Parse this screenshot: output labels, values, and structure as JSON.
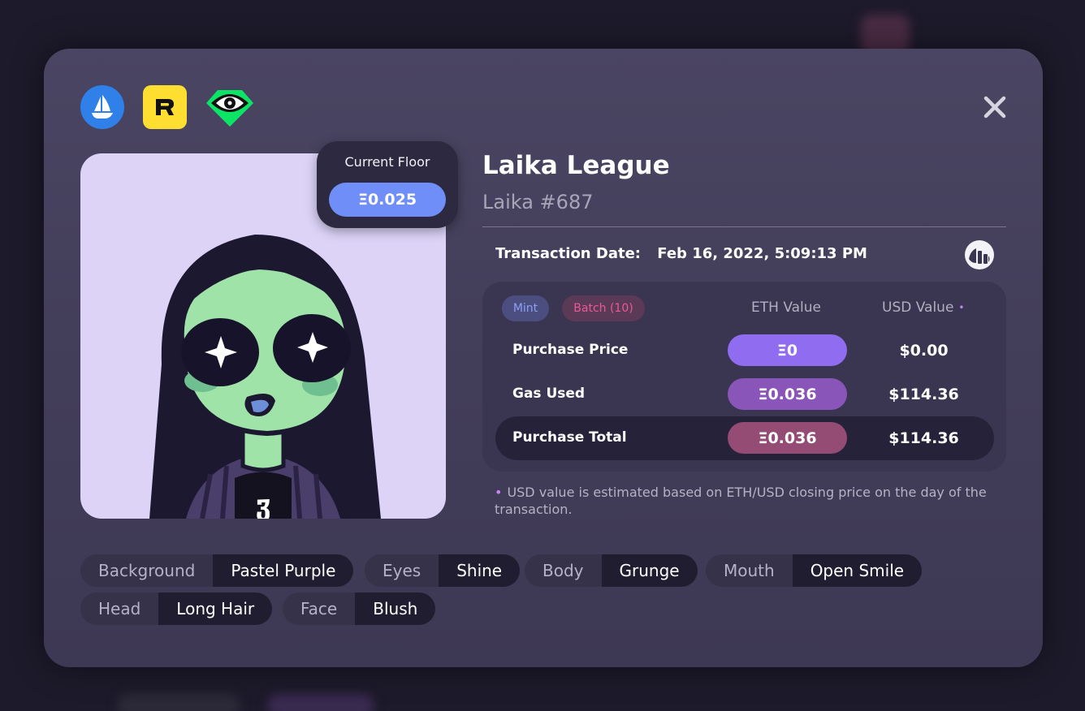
{
  "modal": {
    "marketplaces": [
      "opensea-icon",
      "rarible-icon",
      "looksrare-icon"
    ],
    "close_icon": "close-icon"
  },
  "floor": {
    "label": "Current Floor",
    "value": "Ξ0.025"
  },
  "nft": {
    "collection": "Laika League",
    "token": "Laika #687"
  },
  "transaction": {
    "date_label": "Transaction Date:",
    "date_value": "Feb 16, 2022, 5:09:13 PM",
    "chart_icon": "chart-icon",
    "tags": {
      "mint": "Mint",
      "batch": "Batch (10)"
    },
    "columns": {
      "eth": "ETH Value",
      "usd": "USD Value",
      "usd_dot": "•"
    },
    "rows": [
      {
        "label": "Purchase Price",
        "eth": "Ξ0",
        "usd": "$0.00",
        "color": "#8f6cf0"
      },
      {
        "label": "Gas Used",
        "eth": "Ξ0.036",
        "usd": "$114.36",
        "color": "#8a55b8"
      },
      {
        "label": "Purchase Total",
        "eth": "Ξ0.036",
        "usd": "$114.36",
        "color": "#944c75"
      }
    ]
  },
  "footnote": {
    "dot": "•",
    "text": "USD value is estimated based on ETH/USD closing price on the day of the transaction."
  },
  "traits": [
    {
      "key": "Background",
      "value": "Pastel Purple"
    },
    {
      "key": "Eyes",
      "value": "Shine"
    },
    {
      "key": "Body",
      "value": "Grunge"
    },
    {
      "key": "Mouth",
      "value": "Open Smile"
    },
    {
      "key": "Head",
      "value": "Long Hair"
    },
    {
      "key": "Face",
      "value": "Blush"
    }
  ]
}
